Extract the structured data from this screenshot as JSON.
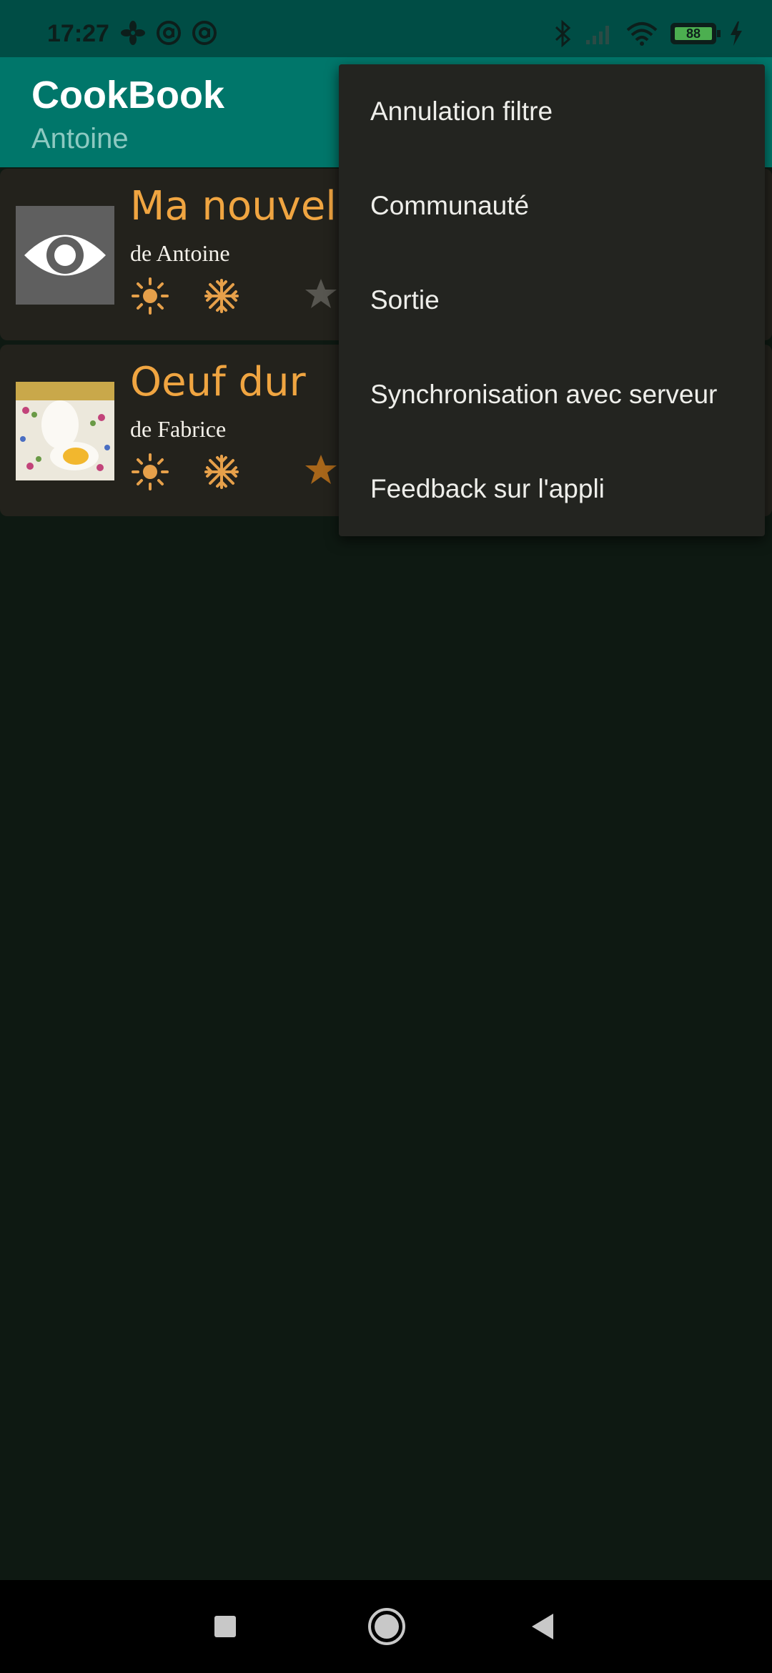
{
  "status_bar": {
    "time": "17:27",
    "left_icons": [
      "fan-icon",
      "at-sign-icon",
      "at-sign-icon"
    ],
    "right_icons": [
      "bluetooth-icon",
      "signal-icon",
      "wifi-icon",
      "battery-icon",
      "charging-icon"
    ],
    "battery": "88"
  },
  "app_bar": {
    "title": "CookBook",
    "subtitle": "Antoine",
    "color": "#00766a"
  },
  "recipes": [
    {
      "title": "Ma nouvelle",
      "author": "de Antoine",
      "thumbnail": "eye-icon",
      "icons": [
        "sun-icon",
        "snowflake-icon",
        "star-icon"
      ],
      "favorite": false
    },
    {
      "title": "Oeuf dur",
      "author": "de Fabrice",
      "thumbnail": "boiled-egg-photo",
      "icons": [
        "sun-icon",
        "snowflake-icon",
        "star-icon"
      ],
      "favorite": true
    }
  ],
  "menu": {
    "items": [
      {
        "label": "Annulation filtre"
      },
      {
        "label": "Communauté"
      },
      {
        "label": "Sortie"
      },
      {
        "label": "Synchronisation avec serveur"
      },
      {
        "label": "Feedback sur l'appli"
      }
    ]
  },
  "nav_bar": {
    "buttons": [
      "recents-square-icon",
      "home-circle-icon",
      "back-triangle-icon"
    ]
  },
  "colors": {
    "accent": "#f0a541",
    "card": "#23221c",
    "menu": "#232420",
    "background": "#0e1912"
  }
}
